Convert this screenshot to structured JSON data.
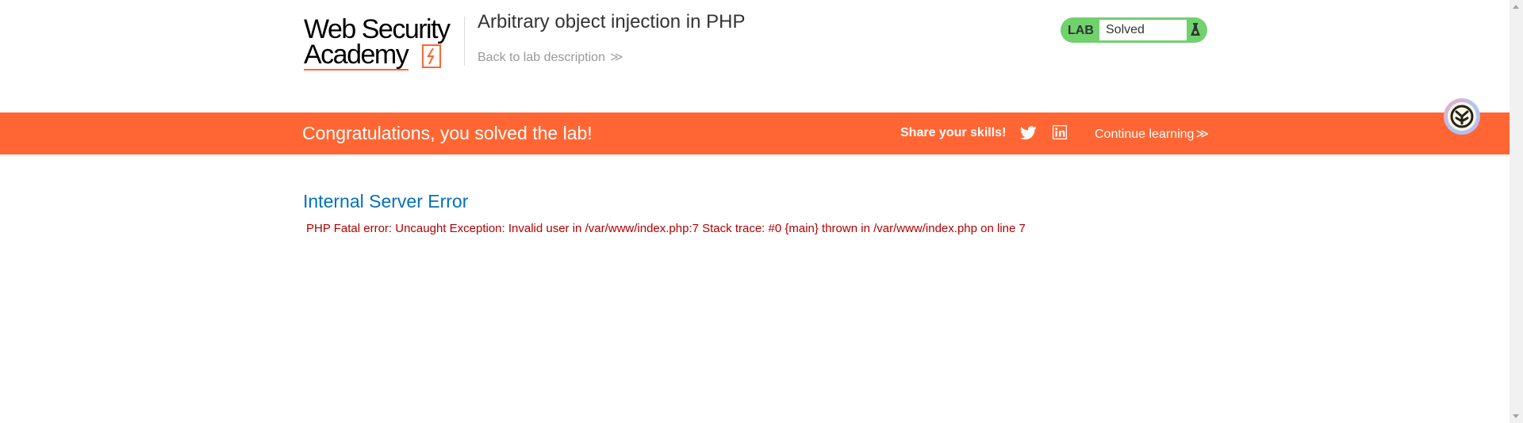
{
  "header": {
    "logo_text_line1": "Web Security",
    "logo_text_line2": "Academy",
    "lab_title": "Arbitrary object injection in PHP",
    "back_link": "Back to lab description",
    "back_chevron": "≫"
  },
  "status": {
    "tag": "LAB",
    "value": "Solved",
    "icon": "flask-icon",
    "color": "#70d16d"
  },
  "banner": {
    "message": "Congratulations, you solved the lab!",
    "share_label": "Share your skills!",
    "share_icons": [
      "twitter-icon",
      "linkedin-icon"
    ],
    "continue_label": "Continue learning",
    "continue_chevron": "≫",
    "color": "#ff6633"
  },
  "content": {
    "error_title": "Internal Server Error",
    "error_message": "PHP Fatal error: Uncaught Exception: Invalid user in /var/www/index.php:7 Stack trace: #0 {main} thrown in /var/www/index.php on line 7"
  },
  "extension": {
    "icon": "browser-extension-icon"
  }
}
